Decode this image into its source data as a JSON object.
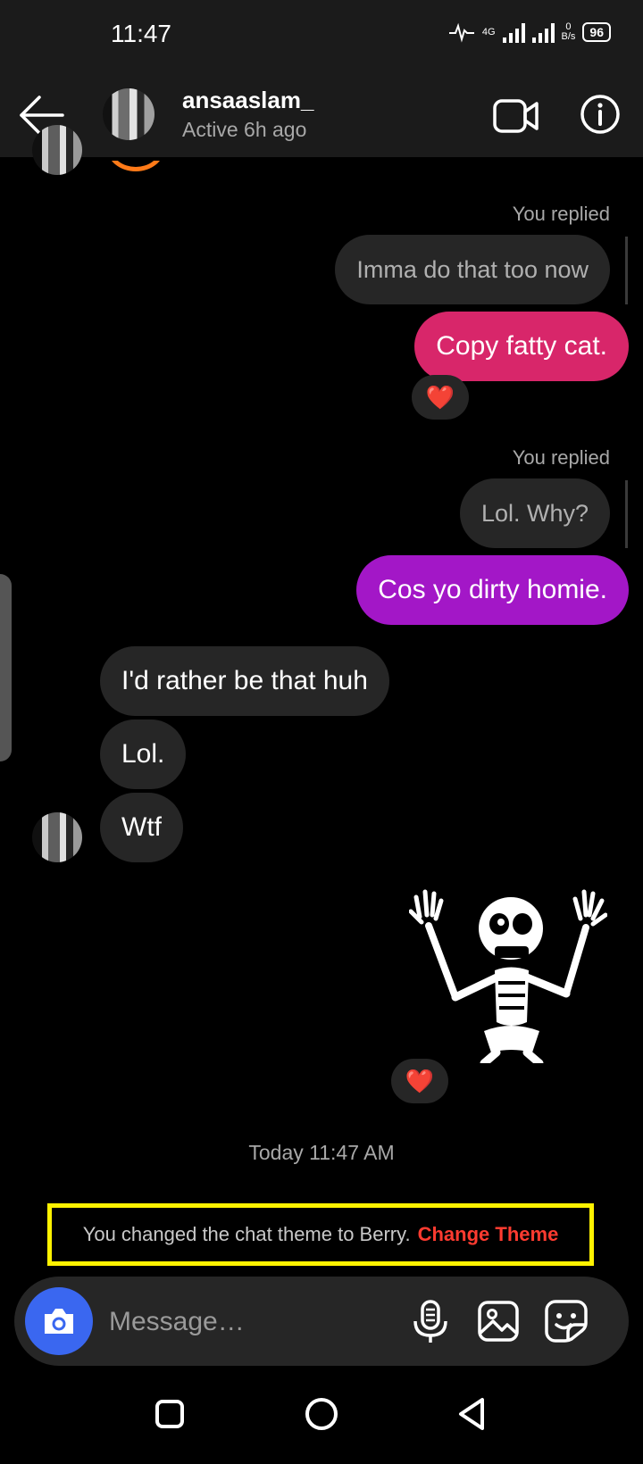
{
  "status_bar": {
    "time": "11:47",
    "network_type": "4G",
    "data_rate_value": "0",
    "data_rate_unit": "B/s",
    "battery": "96"
  },
  "header": {
    "username": "ansaaslam_",
    "active_status": "Active 6h ago"
  },
  "messages": {
    "reply_label_1": "You replied",
    "quoted_1": "Imma do that too now",
    "sent_1": "Copy fatty cat.",
    "reply_label_2": "You replied",
    "quoted_2": "Lol. Why?",
    "sent_2": "Cos yo dirty homie.",
    "incoming_1": "I'd rather be that huh",
    "incoming_2": "Lol.",
    "incoming_3": "Wtf",
    "reaction": "❤️"
  },
  "timestamp": "Today 11:47 AM",
  "theme_notice": {
    "text": "You changed the chat theme to Berry.",
    "link": "Change Theme"
  },
  "composer": {
    "placeholder": "Message…"
  },
  "colors": {
    "accent_blue": "#3a67f0",
    "berry_pink": "#d8266a",
    "berry_purple": "#a317c7",
    "link_red": "#ff3b30",
    "highlight_yellow": "#fff200"
  }
}
